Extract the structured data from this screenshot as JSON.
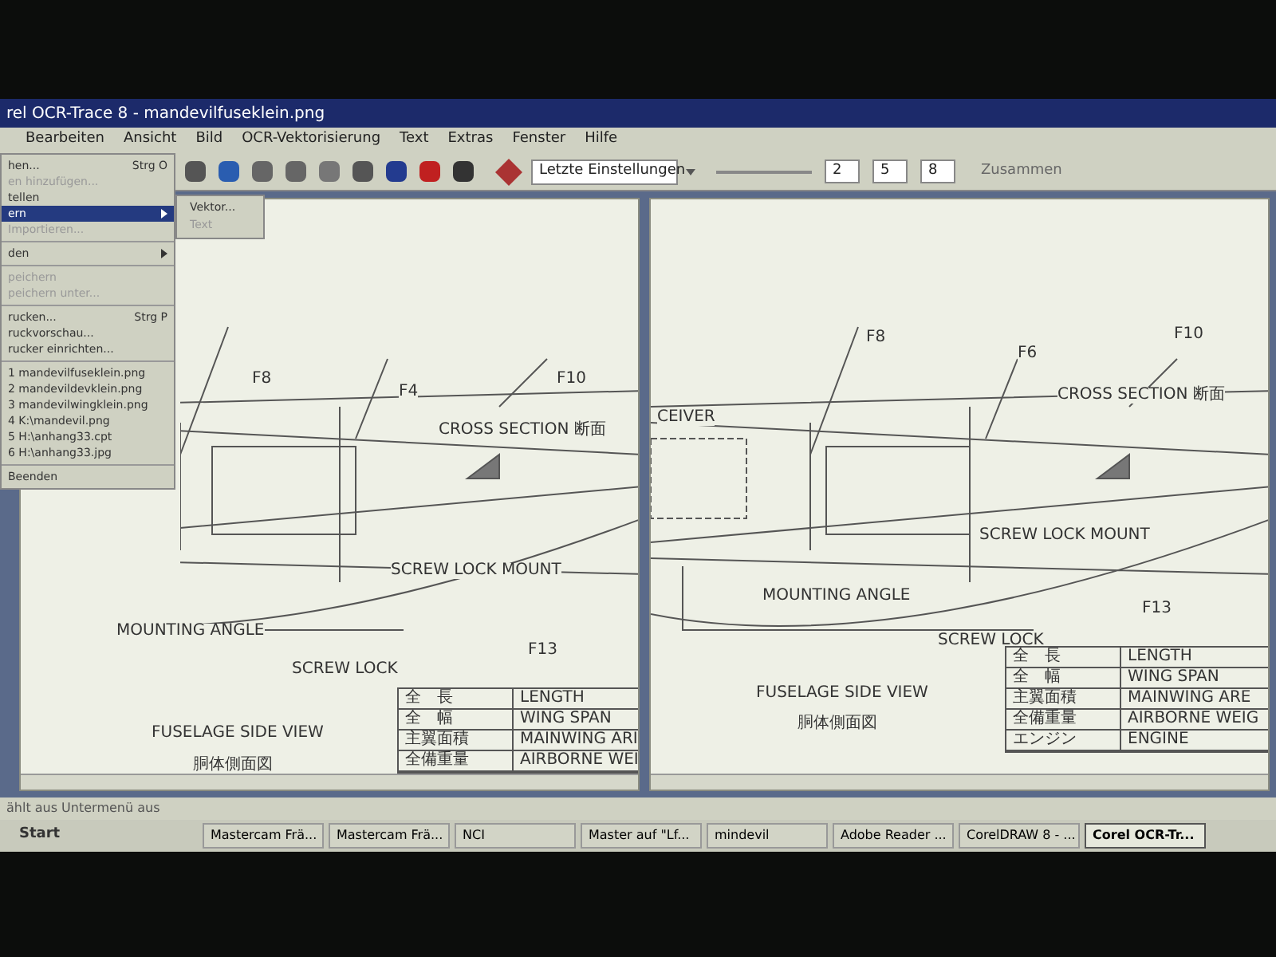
{
  "window": {
    "title": "rel OCR-Trace 8 - mandevilfuseklein.png"
  },
  "menu_bar": [
    {
      "label": "Bearbeiten"
    },
    {
      "label": "Ansicht"
    },
    {
      "label": "Bild"
    },
    {
      "label": "OCR-Vektorisierung"
    },
    {
      "label": "Text"
    },
    {
      "label": "Extras"
    },
    {
      "label": "Fenster"
    },
    {
      "label": "Hilfe"
    }
  ],
  "toolbar": {
    "preset": "Letzte Einstellungen",
    "field_1": "2",
    "field_2": "5",
    "field_3": "8",
    "merge_label": "Zusammen"
  },
  "file_menu": [
    {
      "kind": "item",
      "label": "hen...",
      "shortcut": "Strg O",
      "disabled": false,
      "selected": false,
      "submenu": false
    },
    {
      "kind": "item",
      "label": "en hinzufügen...",
      "disabled": true,
      "selected": false,
      "submenu": false
    },
    {
      "kind": "item",
      "label": "tellen",
      "disabled": false,
      "selected": false,
      "submenu": false
    },
    {
      "kind": "item",
      "label": "ern",
      "disabled": false,
      "selected": true,
      "submenu": true
    },
    {
      "kind": "item",
      "label": "Importieren...",
      "disabled": true,
      "selected": false,
      "submenu": false
    },
    {
      "kind": "separator"
    },
    {
      "kind": "item",
      "label": "den",
      "disabled": false,
      "selected": false,
      "submenu": true
    },
    {
      "kind": "separator"
    },
    {
      "kind": "item",
      "label": "peichern",
      "disabled": true,
      "selected": false,
      "submenu": false
    },
    {
      "kind": "item",
      "label": "peichern unter...",
      "disabled": true,
      "selected": false,
      "submenu": false
    },
    {
      "kind": "separator"
    },
    {
      "kind": "item",
      "label": "rucken...",
      "shortcut": "Strg P",
      "disabled": false,
      "selected": false,
      "submenu": false
    },
    {
      "kind": "item",
      "label": "ruckvorschau...",
      "disabled": false,
      "selected": false,
      "submenu": false
    },
    {
      "kind": "item",
      "label": "rucker einrichten...",
      "disabled": false,
      "selected": false,
      "submenu": false
    },
    {
      "kind": "separator"
    },
    {
      "kind": "item",
      "label": "1 mandevilfuseklein.png",
      "disabled": false,
      "selected": false,
      "submenu": false
    },
    {
      "kind": "item",
      "label": "2 mandevildevklein.png",
      "disabled": false,
      "selected": false,
      "submenu": false
    },
    {
      "kind": "item",
      "label": "3 mandevilwingklein.png",
      "disabled": false,
      "selected": false,
      "submenu": false
    },
    {
      "kind": "item",
      "label": "4 K:\\mandevil.png",
      "disabled": false,
      "selected": false,
      "submenu": false
    },
    {
      "kind": "item",
      "label": "5 H:\\anhang33.cpt",
      "disabled": false,
      "selected": false,
      "submenu": false
    },
    {
      "kind": "item",
      "label": "6 H:\\anhang33.jpg",
      "disabled": false,
      "selected": false,
      "submenu": false
    },
    {
      "kind": "separator"
    },
    {
      "kind": "item",
      "label": "Beenden",
      "disabled": false,
      "selected": false,
      "submenu": false
    }
  ],
  "submenu": [
    {
      "label": "Vektor...",
      "disabled": false
    },
    {
      "label": "Text",
      "disabled": true
    }
  ],
  "documents": [
    {
      "callouts": [
        "F8",
        "F4",
        "F10",
        "CROSS SECTION 断面",
        "SCREW LOCK MOUNT",
        "MOUNTING ANGLE",
        "SCREW LOCK",
        "F13",
        "FUSELAGE SIDE VIEW",
        "胴体側面図"
      ],
      "table": [
        {
          "ja": "全　長",
          "en": "LENGTH"
        },
        {
          "ja": "全　幅",
          "en": "WING SPAN"
        },
        {
          "ja": "主翼面積",
          "en": "MAINWING ARI"
        },
        {
          "ja": "全備重量",
          "en": "AIRBORNE WEI"
        }
      ]
    },
    {
      "callouts": [
        "F8",
        "F6",
        "F10",
        "CROSS SECTION 断面",
        "SCREW LOCK MOUNT",
        "MOUNTING ANGLE",
        "SCREW LOCK",
        "F13",
        "FUSELAGE SIDE VIEW",
        "胴体側面図",
        "CEIVER"
      ],
      "table": [
        {
          "ja": "全　長",
          "en": "LENGTH"
        },
        {
          "ja": "全　幅",
          "en": "WING SPAN"
        },
        {
          "ja": "主翼面積",
          "en": "MAINWING ARE"
        },
        {
          "ja": "全備重量",
          "en": "AIRBORNE WEIG"
        },
        {
          "ja": "エンジン",
          "en": "ENGINE"
        }
      ]
    }
  ],
  "status_bar": "ählt aus Untermenü aus",
  "taskbar": {
    "start": "Start",
    "tasks": [
      {
        "label": "Mastercam Frä...",
        "selected": false
      },
      {
        "label": "Mastercam Frä...",
        "selected": false
      },
      {
        "label": "NCI",
        "selected": false
      },
      {
        "label": "Master auf \"Lf...",
        "selected": false
      },
      {
        "label": "mindevil",
        "selected": false
      },
      {
        "label": "Adobe Reader ...",
        "selected": false
      },
      {
        "label": "CorelDRAW 8 - ...",
        "selected": false
      },
      {
        "label": "Corel OCR-Tr...",
        "selected": true
      }
    ]
  }
}
